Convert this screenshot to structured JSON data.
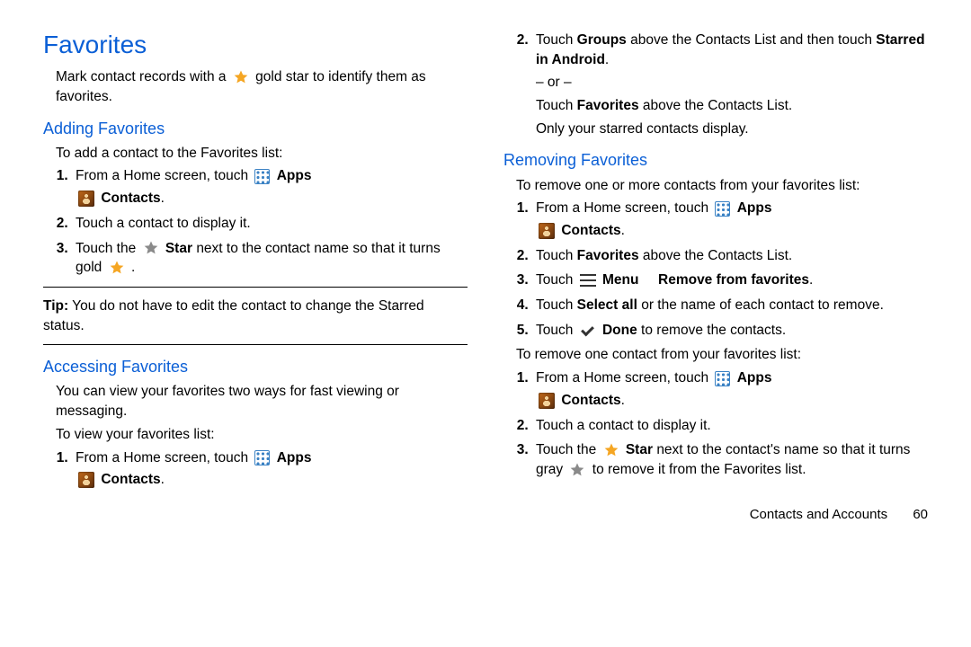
{
  "page_title": "Favorites",
  "intro_before": "Mark contact records with a ",
  "intro_after": " gold star to identify them as favorites.",
  "adding": {
    "heading": "Adding Favorites",
    "intro": "To add a contact to the Favorites list:",
    "steps": {
      "s1_before": "From a Home screen, touch ",
      "s1_apps": "Apps",
      "s1_contacts": "Contacts",
      "s2": "Touch a contact to display it.",
      "s3_before": "Touch the ",
      "s3_star": "Star",
      "s3_mid": " next to the contact name so that it turns gold ",
      "s3_after": "."
    }
  },
  "tip_label": "Tip:",
  "tip_text": " You do not have to edit the contact to change the Starred status.",
  "accessing": {
    "heading": "Accessing Favorites",
    "intro1": "You can view your favorites two ways for fast viewing or messaging.",
    "intro2": "To view your favorites list:",
    "step1_before": "From a Home screen, touch ",
    "step1_apps": "Apps",
    "step1_contacts": "Contacts",
    "step2_before": "Touch ",
    "step2_groups": "Groups",
    "step2_mid": " above the Contacts List and then touch ",
    "step2_starred": "Starred in Android",
    "or": "– or –",
    "step2_alt_before": "Touch ",
    "step2_alt_fav": "Favorites",
    "step2_alt_after": " above the Contacts List.",
    "result": "Only your starred contacts display."
  },
  "removing": {
    "heading": "Removing Favorites",
    "intro": "To remove one or more contacts from your favorites list:",
    "s1_before": "From a Home screen, touch ",
    "s1_apps": "Apps",
    "s1_contacts": "Contacts",
    "s2_before": "Touch ",
    "s2_fav": "Favorites",
    "s2_after": " above the Contacts List.",
    "s3_before": "Touch ",
    "s3_menu": "Menu",
    "s3_arrow_gap": " ",
    "s3_remove": "Remove from favorites",
    "s4_before": "Touch ",
    "s4_selectall": "Select all",
    "s4_after": " or the name of each contact to remove.",
    "s5_before": "Touch ",
    "s5_done": "Done",
    "s5_after": " to remove the contacts.",
    "intro2": "To remove one contact from your favorites list:",
    "b1_before": "From a Home screen, touch ",
    "b1_apps": "Apps",
    "b1_contacts": "Contacts",
    "b2": "Touch a contact to display it.",
    "b3_before": "Touch the ",
    "b3_star": "Star",
    "b3_mid": " next to the contact's name so that it turns gray ",
    "b3_after": " to remove it from the Favorites list."
  },
  "footer_section": "Contacts and Accounts",
  "footer_page": "60"
}
